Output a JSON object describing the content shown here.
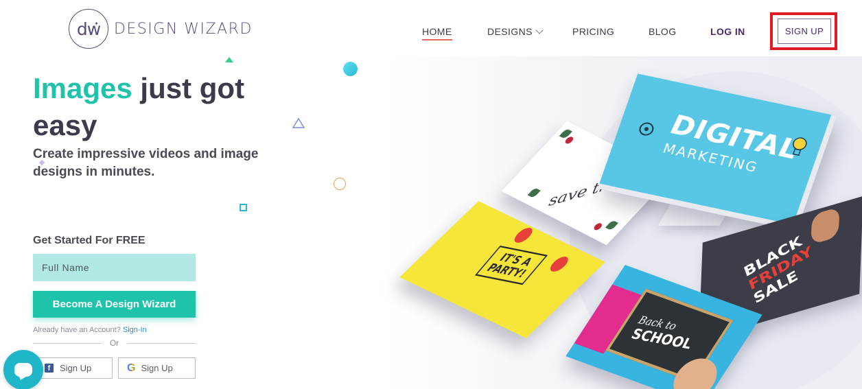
{
  "brand": {
    "monogram": "dw",
    "name": "DESIGN WIZARD"
  },
  "nav": {
    "home": "HOME",
    "designs": "DESIGNS",
    "pricing": "PRICING",
    "blog": "BLOG",
    "login": "LOG IN",
    "signup": "SIGN UP"
  },
  "hero": {
    "title_accent": "Images",
    "title_rest": " just got easy",
    "subtitle": "Create impressive videos and image designs in minutes."
  },
  "form": {
    "heading": "Get Started For FREE",
    "name_placeholder": "Full Name",
    "cta": "Become A Design Wizard",
    "account_prompt": "Already have an Account? ",
    "signin_link": "Sign-In",
    "or": "Or",
    "facebook_signup": "Sign Up",
    "google_signup": "Sign Up"
  },
  "illustration": {
    "monitor_title": "DIGITAL",
    "monitor_subtitle": "MARKETING",
    "party_line1": "IT'S A",
    "party_line2": "PARTY!",
    "friday_line1": "BLACK",
    "friday_line2": "FRIDAY",
    "friday_line3": "SALE",
    "school_line1": "Back to",
    "school_line2": "SCHOOL",
    "wedding_text": "save the date"
  },
  "colors": {
    "accent": "#1fc3a9",
    "brand_purple": "#5a4a7a",
    "highlight_red": "#e01b24",
    "input_bg": "#b2e8e3"
  },
  "icons": {
    "chevron": "chevron-down-icon",
    "facebook": "facebook-icon",
    "google": "google-icon",
    "chat": "chat-icon"
  }
}
